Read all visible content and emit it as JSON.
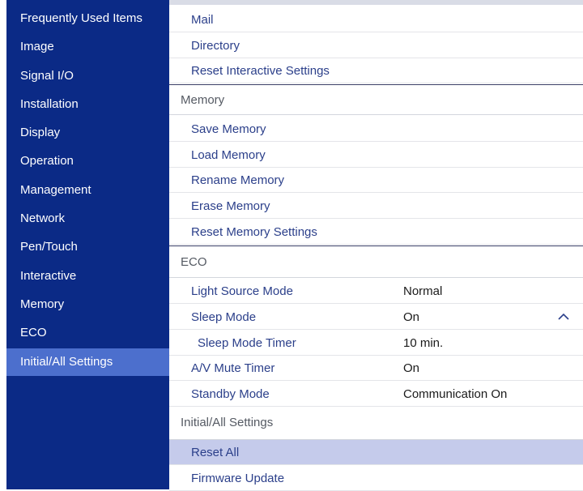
{
  "sidebar": {
    "items": [
      {
        "label": "Frequently Used Items"
      },
      {
        "label": "Image"
      },
      {
        "label": "Signal I/O"
      },
      {
        "label": "Installation"
      },
      {
        "label": "Display"
      },
      {
        "label": "Operation"
      },
      {
        "label": "Management"
      },
      {
        "label": "Network"
      },
      {
        "label": "Pen/Touch"
      },
      {
        "label": "Interactive"
      },
      {
        "label": "Memory"
      },
      {
        "label": "ECO"
      },
      {
        "label": "Initial/All Settings"
      }
    ],
    "selected": "Initial/All Settings"
  },
  "interactive": {
    "mail": "Mail",
    "directory": "Directory",
    "reset_interactive": "Reset Interactive Settings"
  },
  "memory": {
    "header": "Memory",
    "save": "Save Memory",
    "load": "Load Memory",
    "rename": "Rename Memory",
    "erase": "Erase Memory",
    "reset": "Reset Memory Settings"
  },
  "eco": {
    "header": "ECO",
    "light_source_mode": {
      "label": "Light Source Mode",
      "value": "Normal"
    },
    "sleep_mode": {
      "label": "Sleep Mode",
      "value": "On"
    },
    "sleep_mode_timer": {
      "label": "Sleep Mode Timer",
      "value": "10 min."
    },
    "av_mute_timer": {
      "label": "A/V Mute Timer",
      "value": "On"
    },
    "standby_mode": {
      "label": "Standby Mode",
      "value": "Communication On"
    }
  },
  "initial": {
    "header": "Initial/All Settings",
    "reset_all": "Reset All",
    "firmware_update": "Firmware Update"
  },
  "colors": {
    "sidebar_bg": "#0b2a86",
    "sidebar_selected": "#4c6fcd",
    "row_selected": "#c5cbeb",
    "item_text": "#2b3f8a"
  },
  "icons": {
    "sleep_mode_expand": "chevron-up-icon"
  }
}
